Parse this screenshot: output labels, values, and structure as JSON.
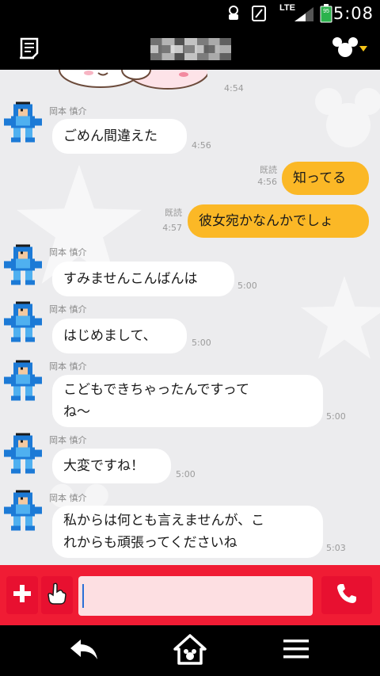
{
  "status_bar": {
    "time": "5:08",
    "network": "LTE",
    "battery_percent": "95",
    "icons": [
      "notification-icon",
      "sim-icon",
      "signal-icon",
      "battery-icon"
    ]
  },
  "header": {
    "title": "",
    "left_icon": "note-icon",
    "right_icon": "mouse-head-menu-icon"
  },
  "chat": {
    "messages": [
      {
        "side": "in",
        "sticker": true,
        "time": "4:54"
      },
      {
        "side": "in",
        "name": "岡本 慎介",
        "text": "ごめん間違えた",
        "time": "4:56"
      },
      {
        "side": "out",
        "text": "知ってる",
        "read": "既読",
        "time": "4:56"
      },
      {
        "side": "out",
        "text": "彼女宛かなんかでしょ",
        "read": "既読",
        "time": "4:57"
      },
      {
        "side": "in",
        "name": "岡本 慎介",
        "text": "すみませんこんばんは",
        "time": "5:00"
      },
      {
        "side": "in",
        "name": "岡本 慎介",
        "text": "はじめまして、",
        "time": "5:00"
      },
      {
        "side": "in",
        "name": "岡本 慎介",
        "text": "こどもできちゃったんですって\nね〜",
        "time": "5:00"
      },
      {
        "side": "in",
        "name": "岡本 慎介",
        "text": "大変ですね！",
        "time": "5:00"
      },
      {
        "side": "in",
        "name": "岡本 慎介",
        "text": "私からは何とも言えませんが、こ\nれからも頑張ってくださいね",
        "time": "5:03"
      }
    ]
  },
  "input_bar": {
    "plus_icon": "plus-icon",
    "sticker_icon": "glove-hand-icon",
    "message_value": "",
    "call_icon": "phone-icon"
  },
  "nav_bar": {
    "icons": [
      "back-arrow-icon",
      "home-icon",
      "menu-icon"
    ]
  },
  "colors": {
    "accent_red": "#f01c34",
    "bubble_out": "#fbb826",
    "bubble_in": "#ffffff",
    "chat_bg": "#ececee"
  }
}
